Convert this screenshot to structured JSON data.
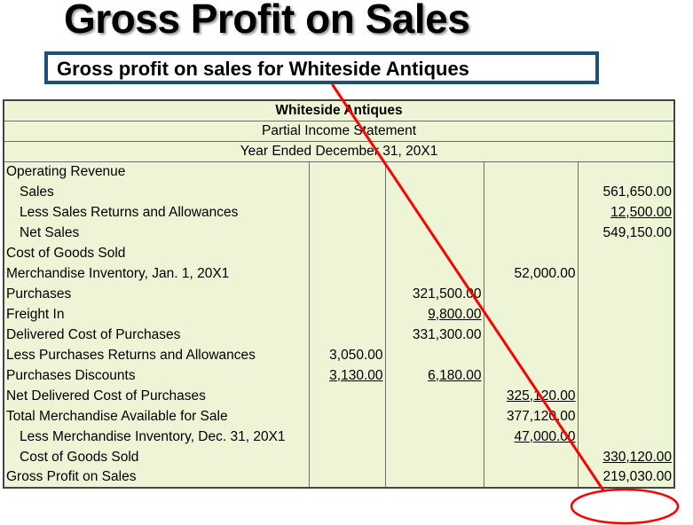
{
  "slide": {
    "title": "Gross Profit on Sales",
    "subtitle": "Gross profit on sales for Whiteside Antiques"
  },
  "statement": {
    "company": "Whiteside Antiques",
    "report": "Partial Income Statement",
    "period": "Year Ended December 31, 20X1",
    "rows": [
      {
        "label": "Operating Revenue",
        "c1": "",
        "c2": "",
        "c3": "",
        "c4": "",
        "indent": false
      },
      {
        "label": "Sales",
        "c1": "",
        "c2": "",
        "c3": "",
        "c4": "561,650.00",
        "indent": true
      },
      {
        "label": "Less Sales Returns and Allowances",
        "c1": "",
        "c2": "",
        "c3": "",
        "c4": "12,500.00",
        "indent": true,
        "u4": true
      },
      {
        "label": "Net Sales",
        "c1": "",
        "c2": "",
        "c3": "",
        "c4": "549,150.00",
        "indent": true
      },
      {
        "label": "Cost of Goods Sold",
        "c1": "",
        "c2": "",
        "c3": "",
        "c4": "",
        "indent": false
      },
      {
        "label": "Merchandise Inventory, Jan. 1, 20X1",
        "c1": "",
        "c2": "",
        "c3": "52,000.00",
        "c4": "",
        "indent": false
      },
      {
        "label": "Purchases",
        "c1": "",
        "c2": "321,500.00",
        "c3": "",
        "c4": "",
        "indent": false
      },
      {
        "label": "Freight In",
        "c1": "",
        "c2": "9,800.00",
        "c3": "",
        "c4": "",
        "indent": false,
        "u2": true
      },
      {
        "label": "Delivered Cost of Purchases",
        "c1": "",
        "c2": "331,300.00",
        "c3": "",
        "c4": "",
        "indent": false
      },
      {
        "label": "Less Purchases Returns and Allowances",
        "c1": "3,050.00",
        "c2": "",
        "c3": "",
        "c4": "",
        "indent": false
      },
      {
        "label": "Purchases Discounts",
        "c1": "3,130.00",
        "c2": "6,180.00",
        "c3": "",
        "c4": "",
        "indent": false,
        "u1": true,
        "u2": true
      },
      {
        "label": "Net Delivered Cost of Purchases",
        "c1": "",
        "c2": "",
        "c3": "325,120.00",
        "c4": "",
        "indent": false,
        "u3": true
      },
      {
        "label": "Total Merchandise Available for Sale",
        "c1": "",
        "c2": "",
        "c3": "377,120.00",
        "c4": "",
        "indent": false
      },
      {
        "label": "Less Merchandise Inventory, Dec. 31, 20X1",
        "c1": "",
        "c2": "",
        "c3": "47,000.00",
        "c4": "",
        "indent": true,
        "u3": true
      },
      {
        "label": "Cost of Goods Sold",
        "c1": "",
        "c2": "",
        "c3": "",
        "c4": "330,120.00",
        "indent": true,
        "u4": true
      },
      {
        "label": "Gross Profit on Sales",
        "c1": "",
        "c2": "",
        "c3": "",
        "c4": "219,030.00",
        "indent": false
      }
    ]
  },
  "annotation": {
    "arrow_color": "#ff0000",
    "highlight_color": "#ff0000",
    "subtitle_border_color": "#1f4e79",
    "table_fill": "#eef5d6"
  }
}
